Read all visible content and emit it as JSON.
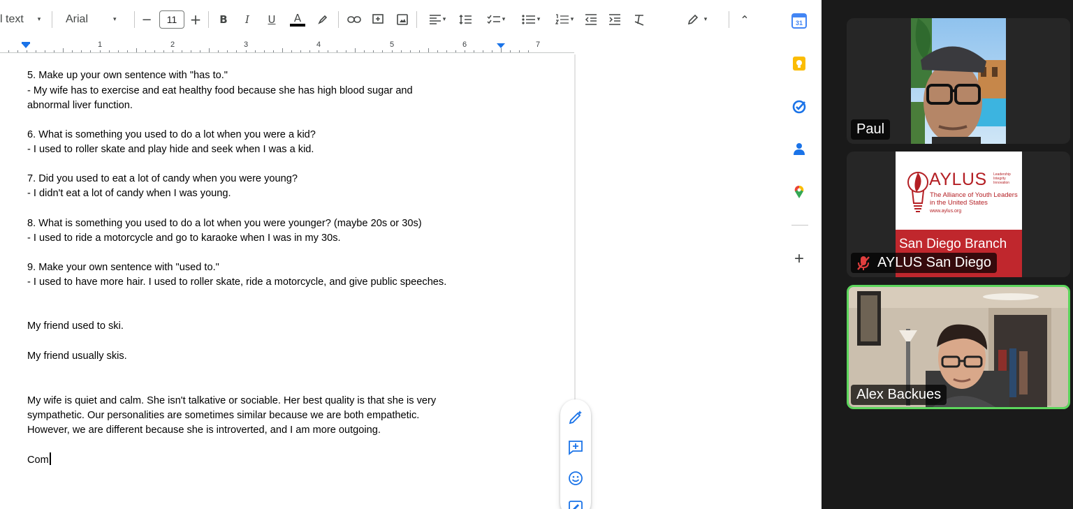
{
  "toolbar": {
    "style_label": "l text",
    "font_label": "Arial",
    "font_size": "11",
    "decrease_font": "−",
    "increase_font": "+",
    "bold": "B",
    "italic": "I",
    "underline": "U",
    "text_color": "A",
    "caret": "▾",
    "collapse": "⌃"
  },
  "ruler": {
    "numbers": [
      "1",
      "2",
      "3",
      "4",
      "5",
      "6",
      "7"
    ]
  },
  "document": {
    "lines": [
      "5. Make up your own sentence with \"has to.\"",
      "   - My wife has to exercise and eat healthy food because she has high blood sugar and",
      "abnormal liver function.",
      "6. What is something you used to do a lot when you were a kid?",
      "   - I used to roller skate and play hide and seek when I was a kid.",
      "7. Did you used to eat a lot of candy when you were young?",
      "   - I didn't eat a lot of candy when I was young.",
      "8. What is something you used to do a lot when you were younger? (maybe 20s or 30s)",
      "   - I used to ride a motorcycle and go to karaoke when I was in my 30s.",
      "9. Make your own sentence with \"used to.\"",
      "   - I used to have more hair. I used to roller skate, ride a motorcycle, and give public speeches.",
      "My friend used to ski.",
      "My friend usually skis.",
      "My wife is quiet and calm. She isn't talkative or sociable. Her best quality is that she is very",
      "sympathetic. Our personalities are sometimes similar because we are both empathetic.",
      "However, we are different because she is introverted, and I am more outgoing.",
      "Com"
    ]
  },
  "side_panel": {
    "calendar_day": "31",
    "add": "+"
  },
  "zoom": {
    "participants": [
      {
        "name": "Paul",
        "muted": false,
        "active": false
      },
      {
        "name": "AYLUS San Diego",
        "muted": true,
        "active": false
      },
      {
        "name": "Alex Backues",
        "muted": false,
        "active": true
      }
    ],
    "aylus_logo": {
      "title": "AYLUS",
      "tagline": [
        "Leadership",
        "Integrity",
        "Innovation"
      ],
      "subtitle_1": "The Alliance of Youth Leaders",
      "subtitle_2": "in the United States",
      "url": "www.aylus.org",
      "branch": "San Diego Branch"
    },
    "colors": {
      "active_border": "#5cd65c",
      "aylus_red": "#c0272d"
    }
  }
}
